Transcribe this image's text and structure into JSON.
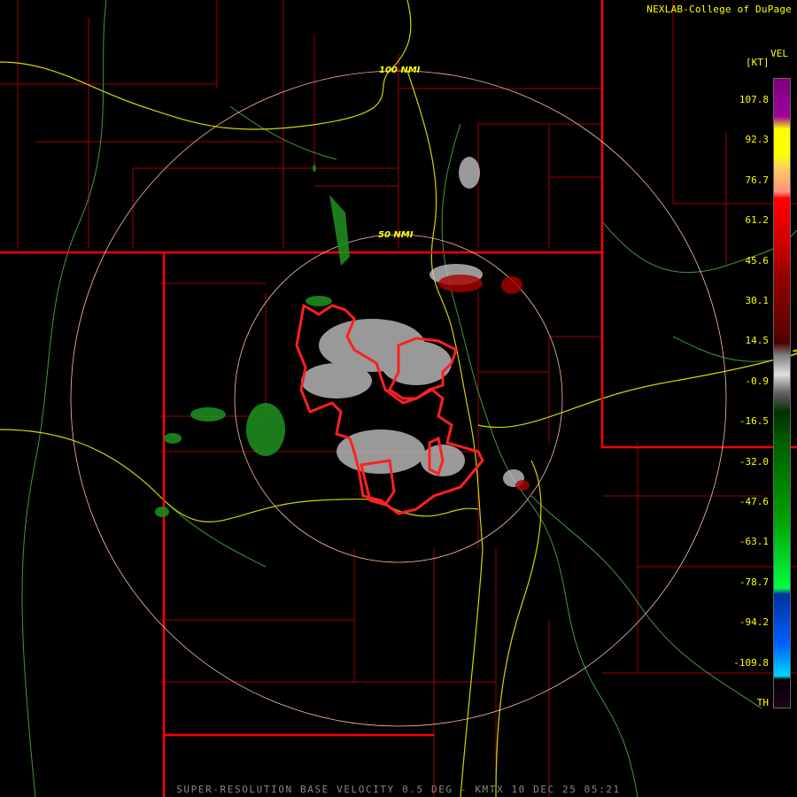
{
  "credit": "NEXLAB-College of DuPage",
  "legend": {
    "title": "VEL",
    "unit": "[KT]",
    "ticks": [
      "107.8",
      "92.3",
      "76.7",
      "61.2",
      "45.6",
      "30.1",
      "14.5",
      "-0.9",
      "-16.5",
      "-32.0",
      "-47.6",
      "-63.1",
      "-78.7",
      "-94.2",
      "-109.8",
      "TH"
    ]
  },
  "rings": {
    "inner": "50 NMI",
    "outer": "100 NMI"
  },
  "footer": "SUPER-RESOLUTION BASE VELOCITY 0.5 DEG - KMTX 10 DEC 25 05:21",
  "colors": {
    "state_lines": "#ff0000",
    "county_lines": "#aa0000",
    "roads": "#ffff00",
    "rivers": "#66cc66",
    "rings": "#ffc0a0",
    "warning_polygon": "#ff0000"
  }
}
